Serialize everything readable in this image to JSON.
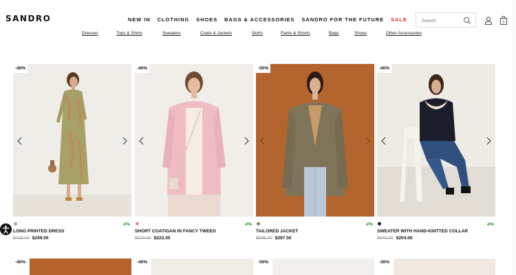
{
  "brand": "SANDRO",
  "nav": {
    "items": [
      "NEW IN",
      "CLOTHING",
      "SHOES",
      "BAGS & ACCESSORIES",
      "SANDRO FOR THE FUTURE"
    ],
    "sale": "SALE"
  },
  "search": {
    "placeholder": "Search"
  },
  "subnav": [
    "Dresses",
    "Tops & Shirts",
    "Sweaters",
    "Coats & Jackets",
    "Skirts",
    "Pants & Shorts",
    "Bags",
    "Shoes",
    "Other Accessories"
  ],
  "products": [
    {
      "discount": "-40%",
      "name": "LONG PRINTED DRESS",
      "old_price": "$415.00",
      "new_price": "$249.00",
      "swatch": "#b7a697"
    },
    {
      "discount": "-40%",
      "name": "SHORT COATIGAN IN FANCY TWEED",
      "old_price": "$370.00",
      "new_price": "$222.00",
      "swatch": "#e58aa3"
    },
    {
      "discount": "-50%",
      "name": "TAILORED JACKET",
      "old_price": "$595.00",
      "new_price": "$297.50",
      "swatch": "#8b7d5f"
    },
    {
      "discount": "-40%",
      "name": "SWEATER WITH HAND-KNITTED COLLAR",
      "old_price": "$340.00",
      "new_price": "$204.00",
      "swatch": "#1b1d2b"
    }
  ],
  "row2_discounts": [
    "-40%",
    "-40%",
    "-50%",
    "-30%"
  ]
}
